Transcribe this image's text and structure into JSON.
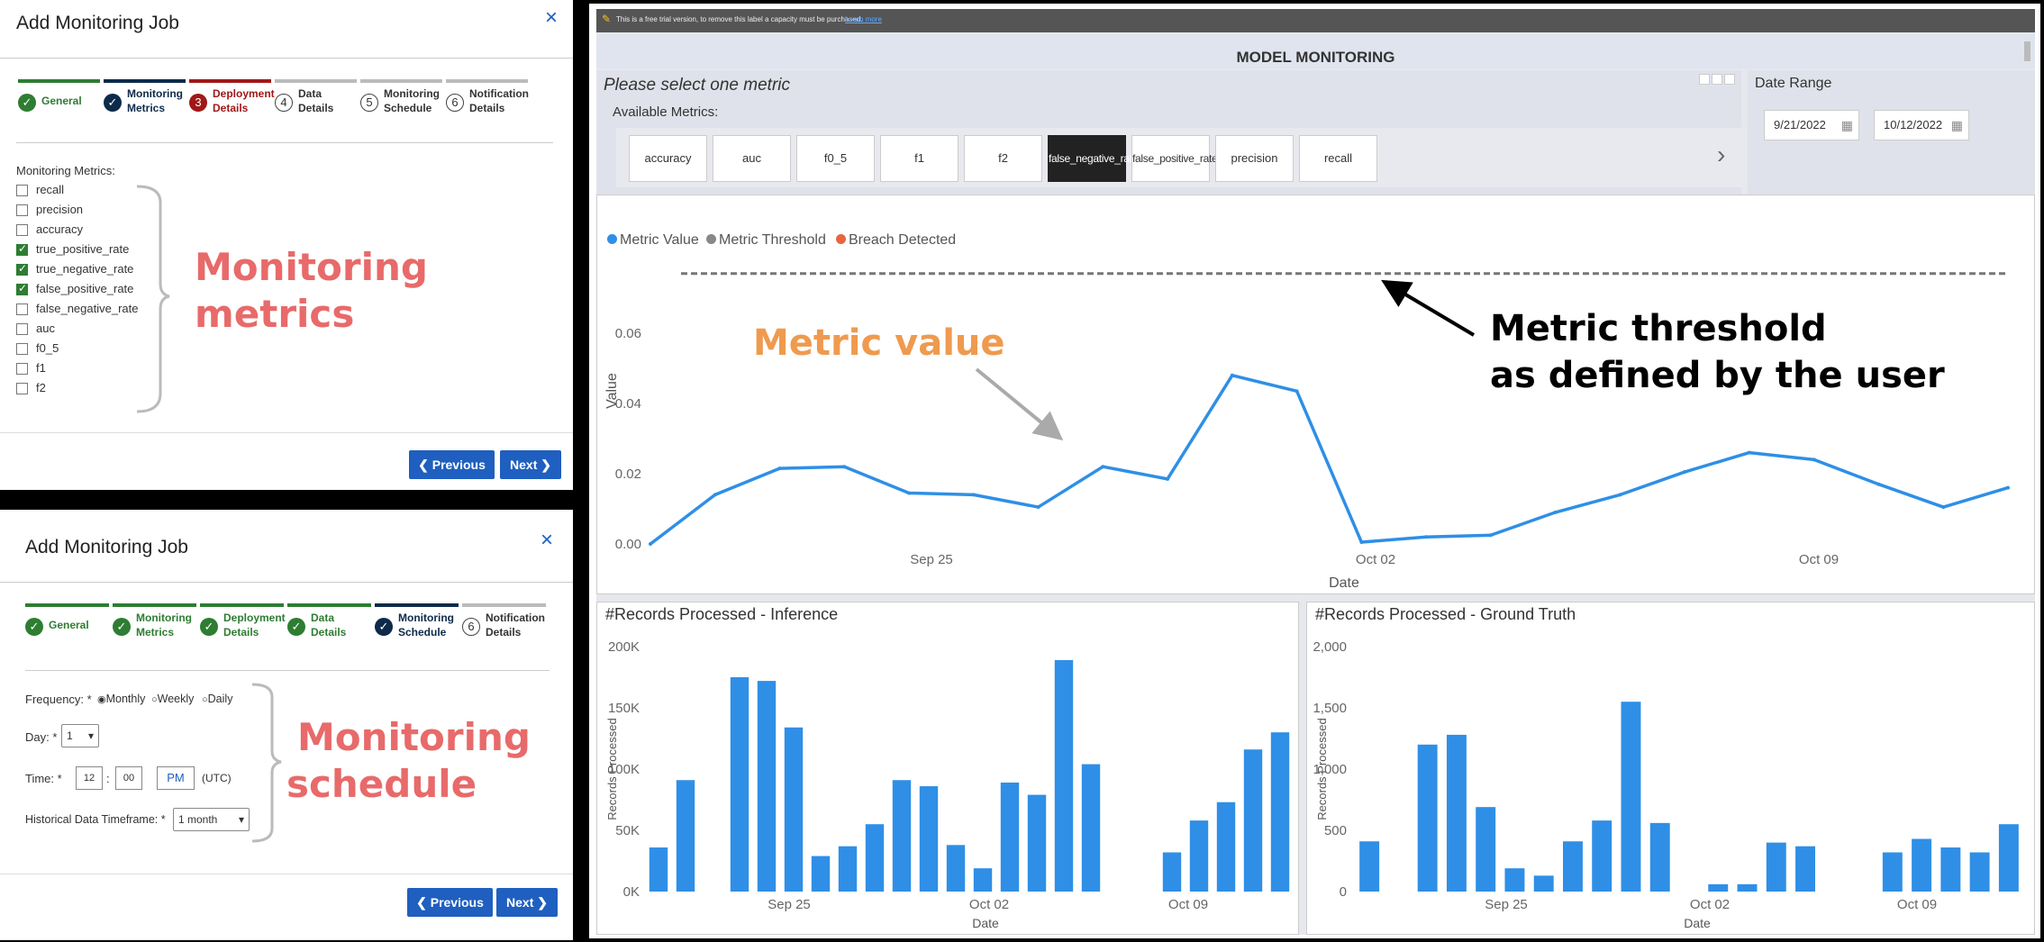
{
  "dialog1": {
    "title": "Add Monitoring Job",
    "close": "×",
    "steps": [
      {
        "num": "",
        "label": "General",
        "state": "done"
      },
      {
        "num": "",
        "label": "Monitoring Metrics",
        "state": "done-navy"
      },
      {
        "num": "3",
        "label": "Deployment Details",
        "state": "current"
      },
      {
        "num": "4",
        "label": "Data Details",
        "state": "todo"
      },
      {
        "num": "5",
        "label": "Monitoring Schedule",
        "state": "todo"
      },
      {
        "num": "6",
        "label": "Notification Details",
        "state": "todo"
      }
    ],
    "metrics_label": "Monitoring Metrics:",
    "metrics": [
      {
        "label": "recall",
        "checked": false
      },
      {
        "label": "precision",
        "checked": false
      },
      {
        "label": "accuracy",
        "checked": false
      },
      {
        "label": "true_positive_rate",
        "checked": true
      },
      {
        "label": "true_negative_rate",
        "checked": true
      },
      {
        "label": "false_positive_rate",
        "checked": true
      },
      {
        "label": "false_negative_rate",
        "checked": false
      },
      {
        "label": "auc",
        "checked": false
      },
      {
        "label": "f0_5",
        "checked": false
      },
      {
        "label": "f1",
        "checked": false
      },
      {
        "label": "f2",
        "checked": false
      }
    ],
    "annotation_line1": "Monitoring",
    "annotation_line2": "metrics",
    "prev_label": "❮  Previous",
    "next_label": "Next  ❯"
  },
  "dialog2": {
    "title": "Add Monitoring Job",
    "close": "×",
    "steps": [
      {
        "num": "",
        "label": "General",
        "state": "done"
      },
      {
        "num": "",
        "label": "Monitoring Metrics",
        "state": "done"
      },
      {
        "num": "",
        "label": "Deployment Details",
        "state": "done"
      },
      {
        "num": "",
        "label": "Data Details",
        "state": "done"
      },
      {
        "num": "",
        "label": "Monitoring Schedule",
        "state": "done-navy"
      },
      {
        "num": "6",
        "label": "Notification Details",
        "state": "todo"
      }
    ],
    "frequency_label": "Frequency: *",
    "frequency_options": [
      "Monthly",
      "Weekly",
      "Daily"
    ],
    "frequency_selected": "Monthly",
    "day_label": "Day: *",
    "day_value": "1",
    "time_label": "Time: *",
    "time_hour": "12",
    "time_min": "00",
    "time_ampm": "PM",
    "time_tz": "(UTC)",
    "hist_label": "Historical Data Timeframe: *",
    "hist_value": "1 month",
    "annotation_line1": "Monitoring",
    "annotation_line2": "schedule",
    "prev_label": "❮  Previous",
    "next_label": "Next  ❯"
  },
  "dashboard": {
    "trial_notice": "This is a free trial version, to remove this label a capacity must be purchased.",
    "trial_link": "Learn more",
    "title": "MODEL MONITORING",
    "select_prompt": "Please select one metric",
    "available_label": "Available Metrics:",
    "metric_buttons": [
      "accuracy",
      "auc",
      "f0_5",
      "f1",
      "f2",
      "false_negative_rate",
      "false_positive_rate",
      "precision",
      "recall"
    ],
    "active_metric": "false_negative_rate",
    "date_range_label": "Date Range",
    "date_start": "9/21/2022",
    "date_end": "10/12/2022",
    "legend": [
      {
        "label": "Metric Value",
        "color": "#2f8fe6"
      },
      {
        "label": "Metric Threshold",
        "color": "#888888"
      },
      {
        "label": "Breach Detected",
        "color": "#e8663d"
      }
    ],
    "annot_metric_value": "Metric value",
    "annot_threshold_line1": "Metric threshold",
    "annot_threshold_line2": "as defined by the user",
    "colors": {
      "accent": "#2f8fe6",
      "annot_orange": "#ef9a4e",
      "annot_red": "#e86a6a"
    }
  },
  "chart_data": [
    {
      "type": "line",
      "title": "",
      "xlabel": "Date",
      "ylabel": "Value",
      "x_ticks": [
        "Sep 25",
        "Oct 02",
        "Oct 09"
      ],
      "x_tick_index": [
        4,
        11,
        18
      ],
      "y_ticks": [
        "0.00",
        "0.02",
        "0.04",
        "0.06"
      ],
      "ylim": [
        0,
        0.07
      ],
      "threshold": 0.077,
      "series": [
        {
          "name": "Metric Value",
          "values": [
            0.0,
            0.014,
            0.0215,
            0.022,
            0.0145,
            0.014,
            0.0105,
            0.022,
            0.0185,
            0.048,
            0.0435,
            0.0005,
            0.002,
            0.0025,
            0.009,
            0.014,
            0.0205,
            0.026,
            0.024,
            0.017,
            0.0105,
            0.016
          ]
        }
      ]
    },
    {
      "type": "bar",
      "title": "#Records Processed - Inference",
      "xlabel": "Date",
      "ylabel": "Records Processed",
      "x_ticks": [
        "Sep 25",
        "Oct 02",
        "Oct 09"
      ],
      "x_tick_index": [
        4,
        11,
        18
      ],
      "y_ticks": [
        "0K",
        "50K",
        "100K",
        "150K",
        "200K"
      ],
      "ylim": [
        0,
        200000
      ],
      "values": [
        36000,
        91000,
        0,
        175000,
        172000,
        134000,
        29000,
        37000,
        55000,
        91000,
        86000,
        38000,
        19000,
        89000,
        79000,
        189000,
        104000,
        0,
        0,
        32000,
        58000,
        73000,
        116000,
        130000
      ]
    },
    {
      "type": "bar",
      "title": "#Records Processed - Ground Truth",
      "xlabel": "Date",
      "ylabel": "Records Processed",
      "x_ticks": [
        "Sep 25",
        "Oct 02",
        "Oct 09"
      ],
      "x_tick_index": [
        4,
        11,
        18
      ],
      "y_ticks": [
        "0",
        "500",
        "1,000",
        "1,500",
        "2,000"
      ],
      "ylim": [
        0,
        2000
      ],
      "values": [
        410,
        0,
        1200,
        1280,
        690,
        190,
        130,
        410,
        580,
        1550,
        560,
        0,
        60,
        60,
        400,
        370,
        0,
        0,
        320,
        430,
        360,
        320,
        550
      ]
    }
  ]
}
